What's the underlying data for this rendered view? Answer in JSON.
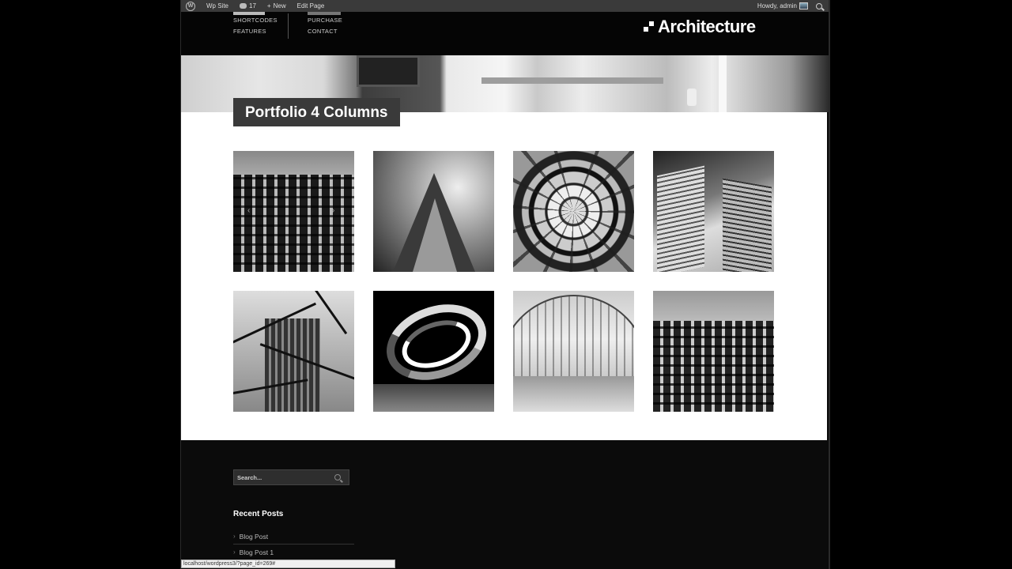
{
  "adminbar": {
    "site_name": "Wp Site",
    "comments_count": "17",
    "new_label": "New",
    "edit_label": "Edit Page",
    "greeting": "Howdy, admin"
  },
  "header": {
    "nav_col1": [
      "SHORTCODES",
      "FEATURES"
    ],
    "nav_col2": [
      "PURCHASE",
      "CONTACT"
    ],
    "logo_text": "Architecture"
  },
  "page": {
    "title": "Portfolio 4 Columns"
  },
  "portfolio": {
    "item_count": 8
  },
  "footer": {
    "search_placeholder": "Search...",
    "recent_posts_title": "Recent Posts",
    "recent_posts": [
      "Blog Post",
      "Blog Post 1"
    ]
  },
  "statusbar": {
    "url": "localhost/wordpress3/?page_id=269#"
  },
  "colors": {
    "background": "#000000",
    "content": "#ffffff",
    "title_box": "#3a3a3a",
    "adminbar": "#3a3a3a"
  }
}
